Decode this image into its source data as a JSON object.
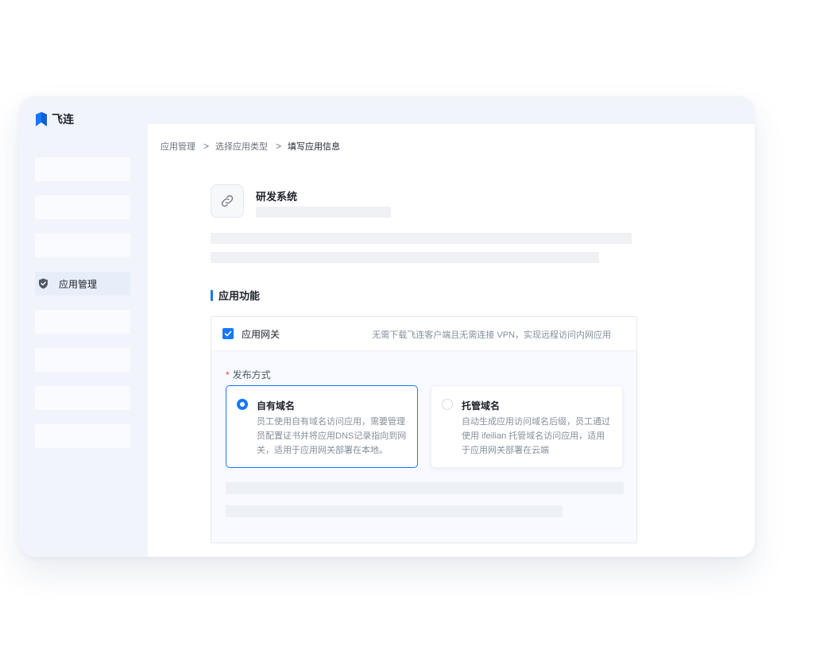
{
  "brand": {
    "name": "飞连",
    "color": "#1677ff"
  },
  "sidebar": {
    "active_item": {
      "label": "应用管理",
      "icon": "shield-icon"
    }
  },
  "breadcrumb": {
    "items": [
      "应用管理",
      "选择应用类型",
      "填写应用信息"
    ],
    "separator": ">"
  },
  "app": {
    "name": "研发系统",
    "icon": "link-icon"
  },
  "section": {
    "title": "应用功能"
  },
  "feature": {
    "label": "应用网关",
    "checked": true,
    "description": "无需下载飞连客户端且无需连接 VPN，实现远程访问内网应用"
  },
  "publish": {
    "label": "发布方式",
    "required_mark": "*",
    "options": [
      {
        "title": "自有域名",
        "selected": true,
        "description": "员工使用自有域名访问应用，需要管理员配置证书并将应用DNS记录指向到网关，适用于应用网关部署在本地。"
      },
      {
        "title": "托管域名",
        "selected": false,
        "description": "自动生成应用访问域名后缀，员工通过使用 ifeilian 托管域名访问应用，适用于应用网关部署在云端"
      }
    ]
  }
}
